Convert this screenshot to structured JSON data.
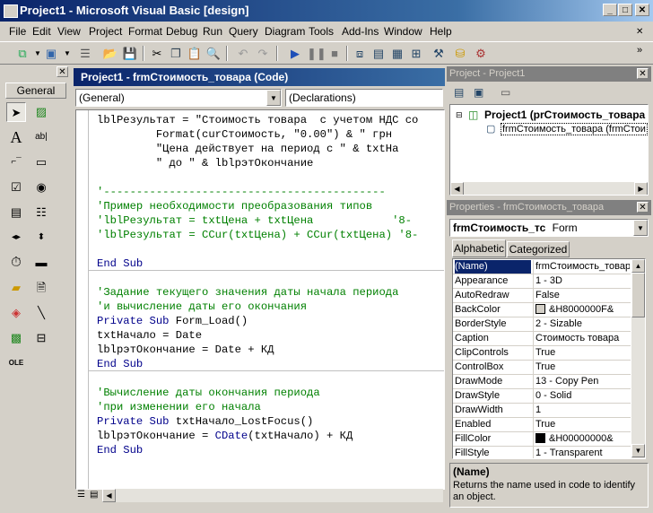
{
  "window": {
    "title": "Project1 - Microsoft Visual Basic [design]"
  },
  "menu": {
    "items": [
      {
        "label": "File"
      },
      {
        "label": "Edit"
      },
      {
        "label": "View"
      },
      {
        "label": "Project"
      },
      {
        "label": "Format"
      },
      {
        "label": "Debug"
      },
      {
        "label": "Run"
      },
      {
        "label": "Query"
      },
      {
        "label": "Diagram"
      },
      {
        "label": "Tools"
      },
      {
        "label": "Add-Ins"
      },
      {
        "label": "Window"
      },
      {
        "label": "Help"
      }
    ]
  },
  "toolbox": {
    "tab_label": "General"
  },
  "code_window": {
    "title": "Project1 - frmСтоимость_товара (Code)",
    "object_combo": "(General)",
    "procedure_combo": "(Declarations)",
    "lines": [
      "lblРезультат = \"Стоимость товара  с учетом НДС со",
      "         Format(curСтоимость, \"0.00\") & \" грн",
      "         \"Цена действует на период с \" & txtНа",
      "         \" до \" & lblрэтОкончание",
      "",
      "'-------------------------------------------",
      "'Пример необходимости преобразования типов",
      "'lblРезультат = txtЦена + txtЦена            '8-",
      "'lblРезультат = CCur(txtЦена) + CCur(txtЦена) '8-",
      "",
      "End Sub",
      "",
      "'Задание текущего значения даты начала периода",
      "'и вычисление даты его окончания",
      "Private Sub Form_Load()",
      "txtНачало = Date",
      "lblрэтОкончание = Date + КД",
      "End Sub",
      "",
      "'Вычисление даты окончания периода",
      "'при изменении его начала",
      "Private Sub txtНачало_LostFocus()",
      "lblрэтОкончание = CDate(txtНачало) + КД",
      "End Sub"
    ]
  },
  "project_explorer": {
    "title": "Project - Project1",
    "project_node": "Project1 (prСтоимость_товара",
    "form_node": "frmСтоимость_товара (frmСтои"
  },
  "properties": {
    "title": "Properties - frmСтоимость_товара",
    "object_name": "frmСтоимость_тс",
    "object_type": "Form",
    "tabs": [
      "Alphabetic",
      "Categorized"
    ],
    "rows": [
      {
        "name": "(Name)",
        "value": "frmСтоимость_товара"
      },
      {
        "name": "Appearance",
        "value": "1 - 3D"
      },
      {
        "name": "AutoRedraw",
        "value": "False"
      },
      {
        "name": "BackColor",
        "value": "&H8000000F&"
      },
      {
        "name": "BorderStyle",
        "value": "2 - Sizable"
      },
      {
        "name": "Caption",
        "value": "Стоимость товара"
      },
      {
        "name": "ClipControls",
        "value": "True"
      },
      {
        "name": "ControlBox",
        "value": "True"
      },
      {
        "name": "DrawMode",
        "value": "13 - Copy Pen"
      },
      {
        "name": "DrawStyle",
        "value": "0 - Solid"
      },
      {
        "name": "DrawWidth",
        "value": "1"
      },
      {
        "name": "Enabled",
        "value": "True"
      },
      {
        "name": "FillColor",
        "value": "&H00000000&"
      },
      {
        "name": "FillStyle",
        "value": "1 - Transparent"
      }
    ],
    "desc_title": "(Name)",
    "desc_text": "Returns the name used in code to identify an object."
  },
  "colors": {
    "selection": "#0a246a",
    "comment": "#008000",
    "keyword": "#00008b"
  }
}
